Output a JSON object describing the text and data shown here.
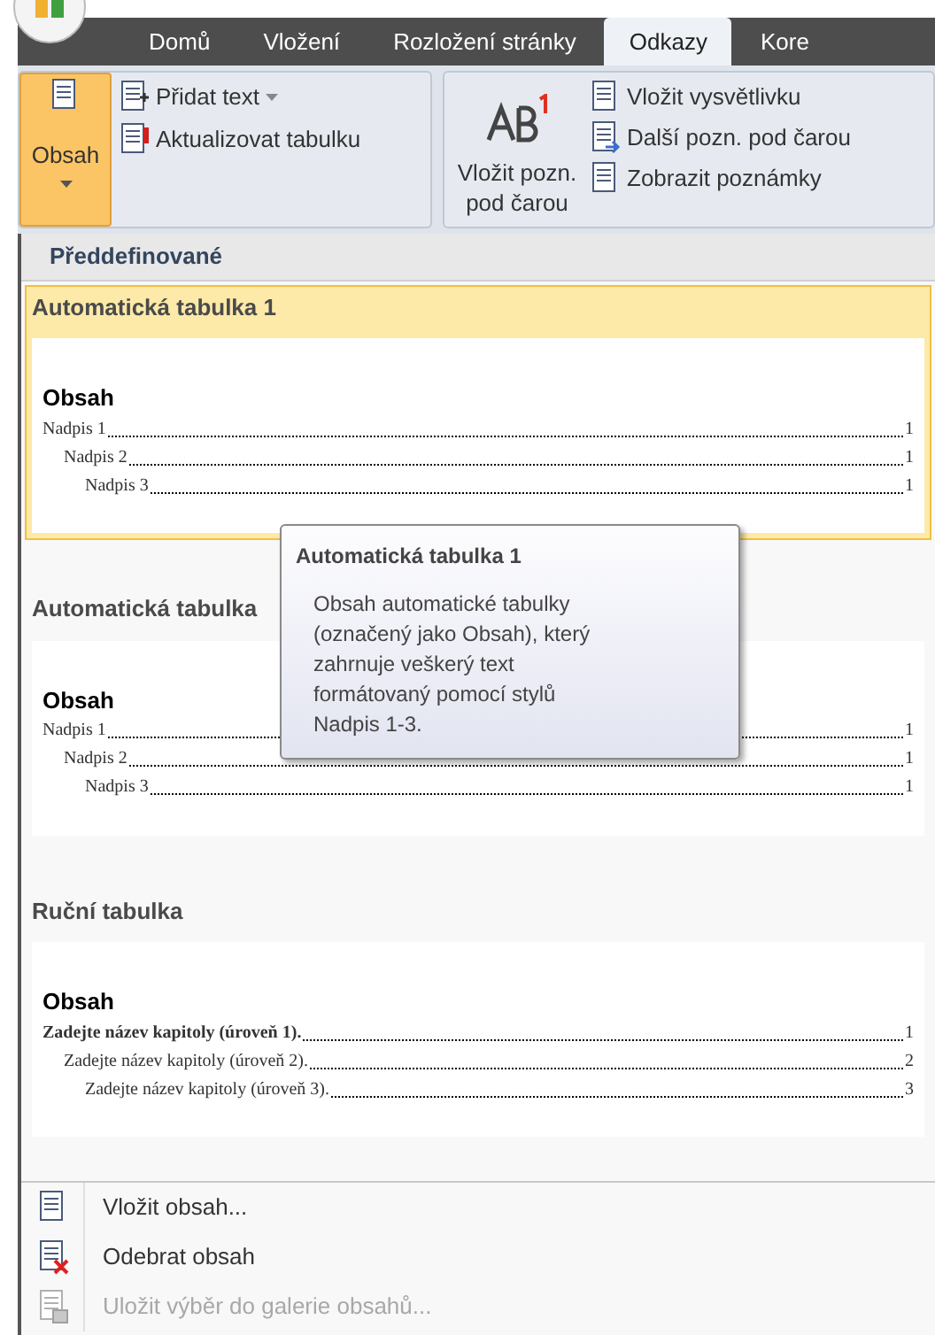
{
  "tabs": [
    {
      "label": "Domů",
      "selected": false
    },
    {
      "label": "Vložení",
      "selected": false
    },
    {
      "label": "Rozložení stránky",
      "selected": false
    },
    {
      "label": "Odkazy",
      "selected": true
    },
    {
      "label": "Kore",
      "selected": false
    }
  ],
  "ribbon": {
    "toc_button": {
      "label": "Obsah",
      "selected": true
    },
    "toc_items": [
      {
        "label": "Přidat text",
        "kind": "dropdown"
      },
      {
        "label": "Aktualizovat tabulku",
        "kind": "update"
      }
    ],
    "footnote_button": {
      "label": "Vložit pozn. pod čarou"
    },
    "footnote_items": [
      {
        "label": "Vložit vysvětlivku",
        "kind": "endnote"
      },
      {
        "label": "Další pozn. pod čarou",
        "kind": "next"
      },
      {
        "label": "Zobrazit poznámky",
        "kind": "show"
      }
    ]
  },
  "menu": {
    "header": "Předdefinované",
    "gallery": [
      {
        "title": "Automatická tabulka 1",
        "selected": true,
        "preview": {
          "heading": "Obsah",
          "entries": [
            {
              "text": "Nadpis 1",
              "page": "1",
              "bold": false,
              "children": [
                {
                  "text": "Nadpis 2",
                  "page": "1",
                  "bold": false,
                  "children": [
                    {
                      "text": "Nadpis 3",
                      "page": "1",
                      "bold": false
                    }
                  ]
                }
              ]
            }
          ]
        }
      },
      {
        "title": "Automatická tabulka",
        "selected": false,
        "preview": {
          "heading": "Obsah",
          "entries": [
            {
              "text": "Nadpis 1",
              "page": "1",
              "bold": false,
              "children": [
                {
                  "text": "Nadpis 2",
                  "page": "1",
                  "bold": false,
                  "children": [
                    {
                      "text": "Nadpis 3",
                      "page": "1",
                      "bold": false
                    }
                  ]
                }
              ]
            }
          ]
        }
      },
      {
        "title": "Ruční tabulka",
        "selected": false,
        "preview": {
          "heading": "Obsah",
          "entries": [
            {
              "text": "Zadejte název kapitoly (úroveň 1).",
              "page": "1",
              "bold": true,
              "children": [
                {
                  "text": "Zadejte název kapitoly (úroveň 2).",
                  "page": "2",
                  "bold": false,
                  "children": [
                    {
                      "text": "Zadejte název kapitoly (úroveň 3).",
                      "page": "3",
                      "bold": false
                    }
                  ]
                }
              ]
            }
          ]
        }
      }
    ],
    "actions": [
      {
        "label": "Vložit obsah...",
        "kind": "insert",
        "disabled": false
      },
      {
        "label": "Odebrat obsah",
        "kind": "remove",
        "disabled": false
      },
      {
        "label": "Uložit výběr do galerie obsahů...",
        "kind": "save",
        "disabled": true
      }
    ]
  },
  "tooltip": {
    "title": "Automatická tabulka 1",
    "text": "Obsah automatické tabulky (označený jako Obsah), který zahrnuje veškerý text formátovaný pomocí stylů Nadpis 1-3."
  }
}
